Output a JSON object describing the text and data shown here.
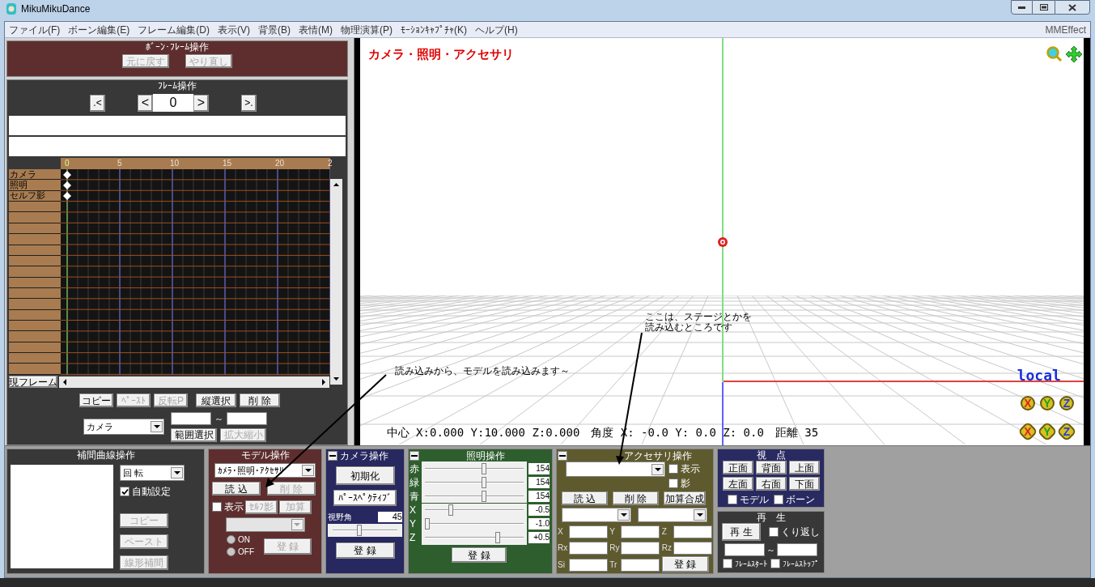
{
  "window": {
    "title": "MikuMikuDance"
  },
  "menu": [
    "ファイル(F)",
    "ボーン編集(E)",
    "フレーム編集(D)",
    "表示(V)",
    "背景(B)",
    "表情(M)",
    "物理演算(P)",
    "ﾓｰｼｮﾝｷｬﾌﾟﾁｬ(K)",
    "ヘルプ(H)"
  ],
  "menu_right": "MMEffect",
  "bone_frame_panel": {
    "title": "ﾎﾞｰﾝ･ﾌﾚｰﾑ操作",
    "buttons": [
      {
        "label": "元に戻す",
        "disabled": true
      },
      {
        "label": "やり直し",
        "disabled": true
      }
    ]
  },
  "frame_panel": {
    "title": "ﾌﾚｰﾑ操作",
    "buttons": [
      ".<",
      "<",
      ">",
      ">."
    ],
    "frame": "0"
  },
  "timeline": {
    "ticks": [
      "0",
      "5",
      "10",
      "15",
      "20",
      "2"
    ],
    "tracks": [
      {
        "label": "カメラ",
        "keyframe": true
      },
      {
        "label": "照明",
        "keyframe": true
      },
      {
        "label": "セルフ影",
        "keyframe": true
      }
    ],
    "current_frame_button": "現フレーム",
    "buttons": [
      {
        "label": "コピー",
        "disabled": false
      },
      {
        "label": "ﾍﾟｰｽﾄ",
        "disabled": true
      },
      {
        "label": "反転P",
        "disabled": true
      },
      {
        "label": "縦選択",
        "disabled": false
      },
      {
        "label": "削 除",
        "disabled": false
      }
    ],
    "target": "カメラ",
    "range_separator": "～",
    "range_buttons": [
      {
        "label": "範囲選択",
        "disabled": false
      },
      {
        "label": "拡大縮小",
        "disabled": true
      }
    ]
  },
  "viewport": {
    "mode": "カメラ・照明・アクセサリ",
    "local_label": "local",
    "status": [
      "中心 X:0.000 Y:10.000 Z:0.000",
      "角度 X: -0.0 Y: 0.0 Z: 0.0",
      "距離 35"
    ],
    "axis_buttons": [
      {
        "kind": "rotate",
        "axes": [
          {
            "label": "X"
          },
          {
            "label": "Y"
          },
          {
            "label": "Z"
          }
        ]
      },
      {
        "kind": "move",
        "axes": [
          {
            "label": "X"
          },
          {
            "label": "Y"
          },
          {
            "label": "Z"
          }
        ]
      }
    ]
  },
  "annotations": [
    {
      "lines": [
        "読み込みから、モデルを読み込みます～"
      ]
    },
    {
      "lines": [
        "ここは、ステージとかを",
        "読み込むところです"
      ]
    }
  ],
  "interpolation_panel": {
    "title": "補間曲線操作",
    "dropdown": "回 転",
    "auto": {
      "label": "自動設定",
      "checked": true
    },
    "buttons": [
      {
        "label": "コピー",
        "disabled": true
      },
      {
        "label": "ペースト",
        "disabled": true
      },
      {
        "label": "線形補間",
        "disabled": true
      }
    ]
  },
  "model_panel": {
    "title": "モデル操作",
    "dropdown": "ｶﾒﾗ･照明･ｱｸｾｻﾘ",
    "buttons": [
      {
        "label": "読 込",
        "disabled": false
      },
      {
        "label": "削 除",
        "disabled": true
      }
    ],
    "show": {
      "label": "表示",
      "checked": false
    },
    "option_buttons": [
      {
        "label": "ｾﾙﾌ影",
        "disabled": true
      },
      {
        "label": "加算",
        "disabled": true
      }
    ],
    "radios": [
      {
        "label": "ON",
        "selected": false
      },
      {
        "label": "OFF",
        "selected": false
      }
    ],
    "register": {
      "label": "登 録",
      "disabled": true
    }
  },
  "camera_panel": {
    "title": "カメラ操作",
    "buttons": [
      {
        "label": "初期化"
      },
      {
        "label": "ﾊﾟｰｽﾍﾟｸﾃｨﾌﾞ"
      }
    ],
    "fov_label": "視野角",
    "fov": "45",
    "fov_slider": {
      "level": 0.4
    },
    "register": "登 録"
  },
  "lighting_panel": {
    "title": "照明操作",
    "colors": [
      {
        "label": "赤",
        "value": "154",
        "level": 0.6
      },
      {
        "label": "緑",
        "value": "154",
        "level": 0.6
      },
      {
        "label": "青",
        "value": "154",
        "level": 0.6
      }
    ],
    "direction": [
      {
        "label": "X",
        "value": "-0.5",
        "level": 0.25
      },
      {
        "label": "Y",
        "value": "-1.0",
        "level": 0.0
      },
      {
        "label": "Z",
        "value": "+0.5",
        "level": 0.75
      }
    ],
    "register": "登 録"
  },
  "accessory_panel": {
    "title": "アクセサリ操作",
    "checks": [
      {
        "label": "表示",
        "checked": false
      },
      {
        "label": "影",
        "checked": false
      }
    ],
    "buttons": [
      "読 込",
      "削 除",
      "加算合成"
    ],
    "fields": [
      "X",
      "Y",
      "Z",
      "Rx",
      "Ry",
      "Rz",
      "Si",
      "Tr"
    ],
    "register": "登 録"
  },
  "viewpoint_panel": {
    "title": "視　点",
    "buttons": [
      "正面",
      "背面",
      "上面",
      "左面",
      "右面",
      "下面"
    ],
    "checks": [
      {
        "label": "モデル",
        "checked": false
      },
      {
        "label": "ボーン",
        "checked": false
      }
    ]
  },
  "playback_panel": {
    "title": "再　生",
    "play": "再 生",
    "loop": {
      "label": "くり返し",
      "checked": false
    },
    "range_separator": "～",
    "checks": [
      {
        "label": "ﾌﾚｰﾑｽﾀｰﾄ",
        "checked": false
      },
      {
        "label": "ﾌﾚｰﾑｽﾄｯﾌﾟ",
        "checked": false
      }
    ]
  }
}
